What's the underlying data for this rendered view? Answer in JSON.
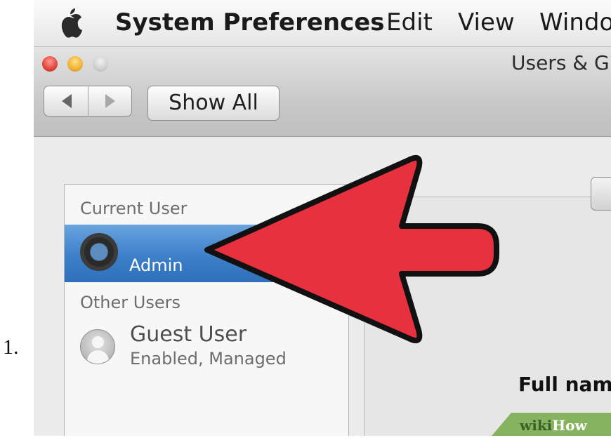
{
  "step_number": "1.",
  "menu_bar": {
    "app_name": "System Preferences",
    "items": [
      "Edit",
      "View",
      "Windo"
    ]
  },
  "window": {
    "title": "Users & G",
    "nav_icons": [
      "back-arrow-icon",
      "forward-arrow-icon"
    ],
    "show_all_label": "Show All"
  },
  "sidebar": {
    "current_user_label": "Current User",
    "current_user": {
      "name": "Admin",
      "selected": true
    },
    "other_users_label": "Other Users",
    "other_users": [
      {
        "name": "Guest User",
        "status": "Enabled, Managed"
      }
    ]
  },
  "details": {
    "full_name_label": "Full nam"
  },
  "annotation": {
    "type": "arrow",
    "color": "#e8313f",
    "outline": "#111111"
  },
  "watermark": {
    "wiki": "wiki",
    "how": "How"
  },
  "colors": {
    "selection": "#3d7fc9",
    "window_chrome": "#c9c9c9"
  }
}
